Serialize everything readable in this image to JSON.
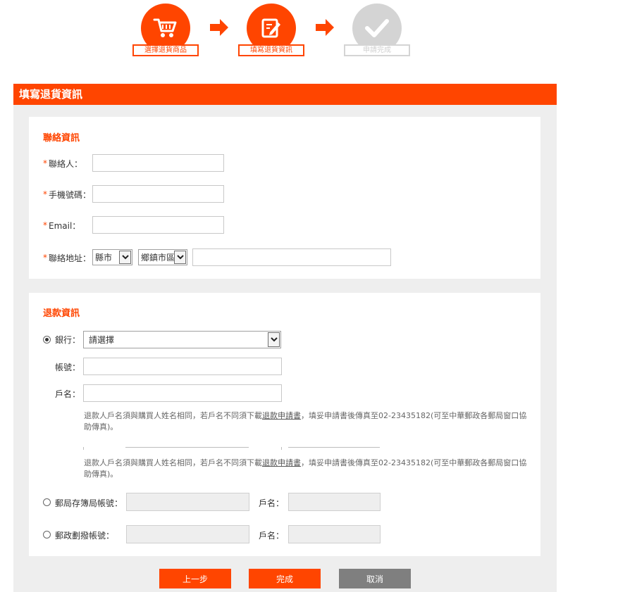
{
  "steps": [
    {
      "label": "選擇退貨商品",
      "icon": "cart-icon",
      "state": "active"
    },
    {
      "label": "填寫退貨資訊",
      "icon": "edit-icon",
      "state": "active"
    },
    {
      "label": "申請完成",
      "icon": "checkmark-icon",
      "state": "pending"
    }
  ],
  "colors": {
    "accent": "#ff4500",
    "pending": "#d4d4d4",
    "panel_bg": "#eeeeee",
    "cancel": "#7f7f7f"
  },
  "panel": {
    "title": "填寫退貨資訊"
  },
  "contact": {
    "title": "聯絡資訊",
    "required_mark": "*",
    "name_label": "聯絡人：",
    "phone_label": "手機號碼：",
    "email_label": "Email：",
    "address_label": "聯絡地址：",
    "city_select": "縣市",
    "district_select": "鄉鎮市區"
  },
  "refund": {
    "title": "退款資訊",
    "bank_label": "銀行：",
    "bank_select": "請選擇",
    "account_label": "帳號：",
    "holder_label": "戶名：",
    "note_prefix": "退款人戶名須與購買人姓名相同，若戶名不同須下載",
    "note_link": "退款申請書",
    "note_suffix": "，填妥申請書後傳真至02-23435182(可至中華郵政各郵局窗口協助傳真)。",
    "post_savings_label": "郵局存簿局帳號：",
    "post_transfer_label": "郵政劃撥帳號：",
    "post_holder_label": "戶名："
  },
  "buttons": {
    "prev": "上一步",
    "finish": "完成",
    "cancel": "取消"
  }
}
